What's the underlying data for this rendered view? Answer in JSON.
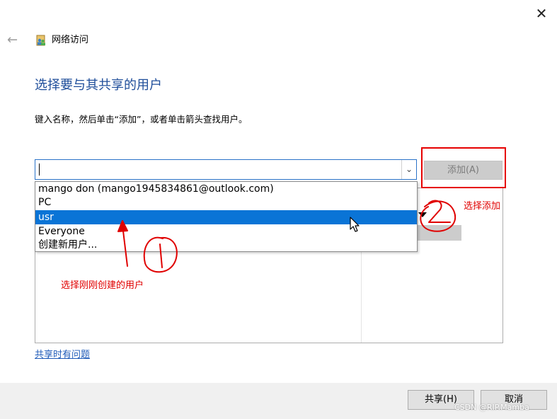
{
  "window": {
    "title": "网络访问",
    "close_glyph": "✕",
    "back_glyph": "←"
  },
  "main": {
    "heading": "选择要与其共享的用户",
    "instruction": "键入名称，然后单击“添加”，或者单击箭头查找用户。",
    "combo": {
      "value": "",
      "dropdown_glyph": "⌄"
    },
    "add_button_label": "添加(A)",
    "dropdown_items": [
      {
        "label": "mango don (mango1945834861@outlook.com)",
        "selected": false
      },
      {
        "label": "PC",
        "selected": false
      },
      {
        "label": "usr",
        "selected": true
      },
      {
        "label": "Everyone",
        "selected": false
      },
      {
        "label": "创建新用户...",
        "selected": false
      }
    ],
    "help_link": "共享时有问题"
  },
  "annotations": {
    "select_user": "选择刚刚创建的用户",
    "select_add": "选择添加",
    "color": "#e00000"
  },
  "footer": {
    "share_button": "共享(H)",
    "cancel_button": "取消",
    "watermark": "CSDN @RIP.Mamba"
  },
  "colors": {
    "accent": "#0a74d6",
    "heading": "#1f4e9a",
    "link": "#1f5bb8"
  }
}
